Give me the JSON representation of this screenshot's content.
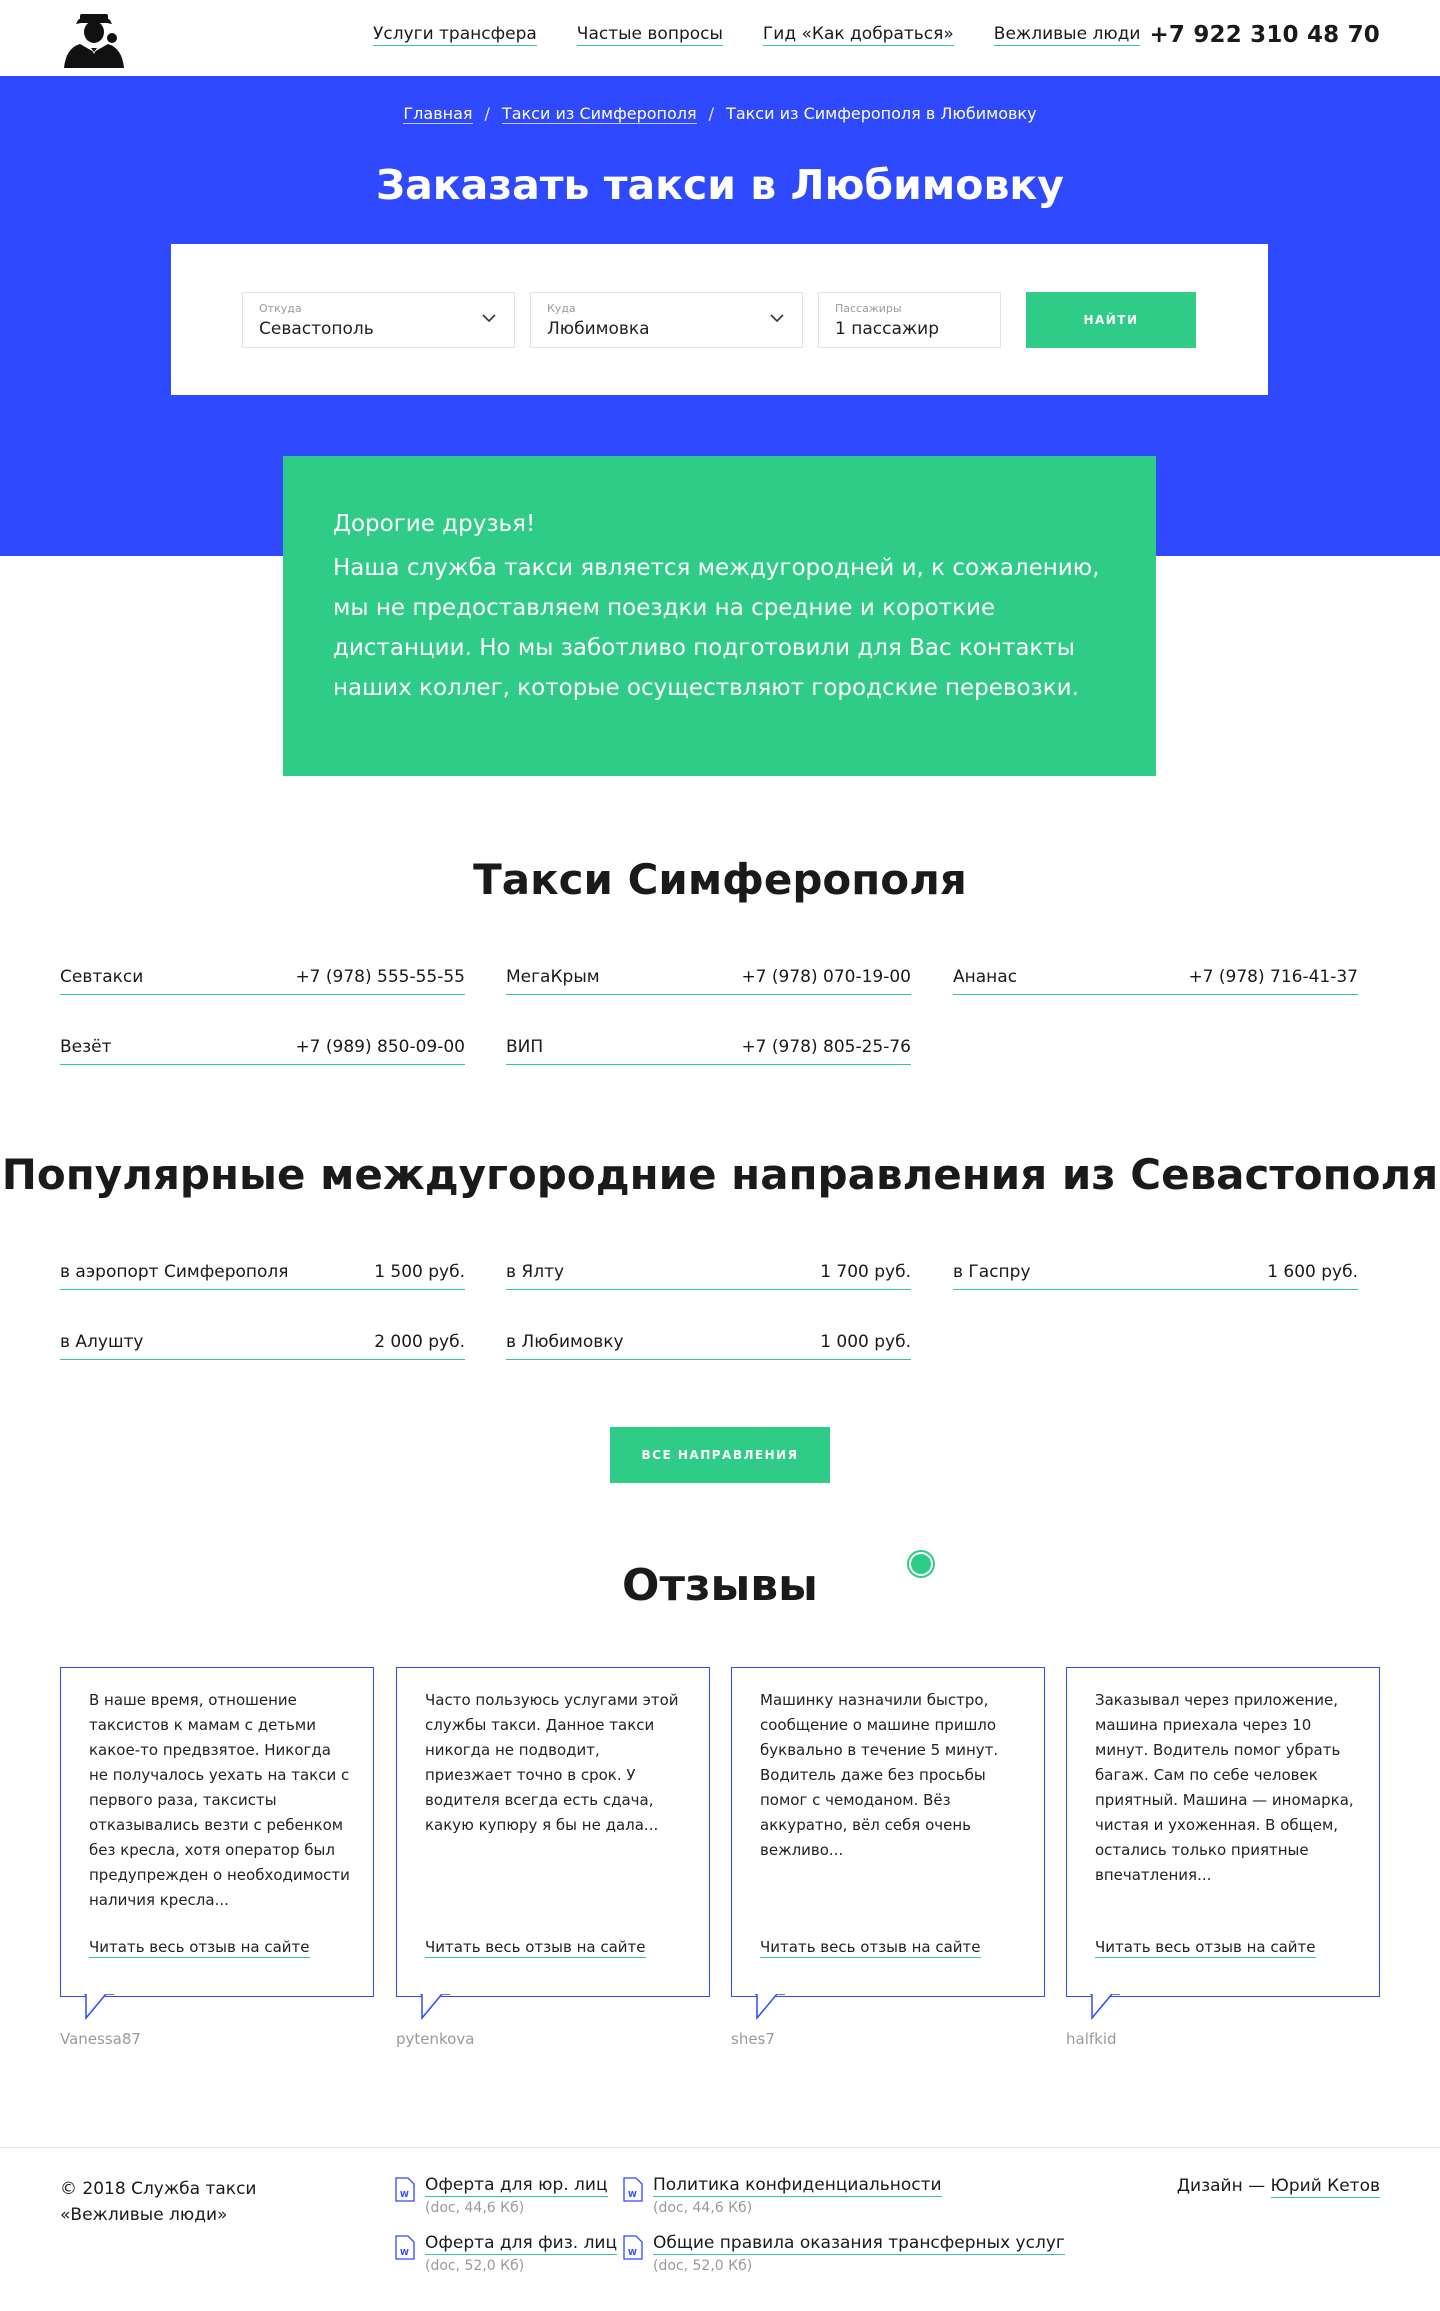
{
  "header": {
    "logo_icon": "gentleman-logo-icon",
    "nav": [
      "Услуги трансфера",
      "Частые вопросы",
      "Гид «Как добраться»",
      "Вежливые люди"
    ],
    "phone": "+7 922 310 48 70"
  },
  "breadcrumbs": {
    "home": "Главная",
    "section": "Такси из Симферополя",
    "current": "Такси из Симферополя в Любимовку",
    "separator": "/"
  },
  "hero": {
    "title": "Заказать такси в Любимовку",
    "background": "#2f49ff"
  },
  "search": {
    "from_label": "Откуда",
    "from_value": "Севастополь",
    "to_label": "Куда",
    "to_value": "Любимовка",
    "passengers_label": "Пассажиры",
    "passengers_value": "1 пассажир",
    "submit": "Найти"
  },
  "notice": {
    "greeting": "Дорогие друзья!",
    "text": "Наша служба такси является междугородней и, к сожалению, мы не предоставляем поездки на средние и короткие дистанции. Но мы заботливо подготовили для Вас контакты наших коллег, которые осуществляют городские перевозки.",
    "background": "#2ecc87"
  },
  "taxi": {
    "title": "Такси Симферополя",
    "items": [
      {
        "name": "Севтакси",
        "phone": "+7 (978) 555-55-55"
      },
      {
        "name": "МегаКрым",
        "phone": "+7 (978) 070-19-00"
      },
      {
        "name": "Ананас",
        "phone": "+7 (978) 716-41-37"
      },
      {
        "name": "Везёт",
        "phone": "+7 (989) 850-09-00"
      },
      {
        "name": "ВИП",
        "phone": "+7 (978) 805-25-76"
      }
    ]
  },
  "routes": {
    "title": "Популярные междугородние направления из Севастополя",
    "items": [
      {
        "name": "в аэропорт Симферополя",
        "price": "1 500 руб."
      },
      {
        "name": "в Ялту",
        "price": "1 700 руб."
      },
      {
        "name": "в Гаспру",
        "price": "1 600 руб."
      },
      {
        "name": "в Алушту",
        "price": "2 000 руб."
      },
      {
        "name": "в Любимовку",
        "price": "1 000 руб."
      }
    ],
    "all_button": "все направления"
  },
  "reviews": {
    "title": "Отзывы",
    "more_label": "Читать весь отзыв на сайте",
    "items": [
      {
        "text": "В наше время, отношение таксистов к мамам с детьми какое-то предвзятое. Никогда не получалось уехать на такси с первого раза, таксисты отказывались везти с ребенком без кресла, хотя оператор был предупрежден о необходимости наличия кресла...",
        "author": "Vanessa87"
      },
      {
        "text": "Часто пользуюсь услугами этой службы такси. Данное такси никогда не подводит, приезжает точно в срок. У водителя всегда есть сдача, какую купюру я бы не дала...",
        "author": "pytenkova"
      },
      {
        "text": "Машинку назначили быстро, сообщение о машине пришло буквально в течение 5 минут. Водитель даже без просьбы помог с чемоданом. Вёз аккуратно, вёл себя очень вежливо...",
        "author": "shes7"
      },
      {
        "text": "Заказывал через приложение, машина приехала через 10 минут. Водитель помог убрать багаж. Сам по себе человек приятный. Машина — иномарка, чистая и ухоженная. В общем, остались только приятные впечатления...",
        "author": "halfkid"
      }
    ]
  },
  "footer": {
    "copyright": "© 2018 Служба такси «Вежливые люди»",
    "docs": [
      {
        "name": "Оферта для юр. лиц",
        "size": "(doc, 44,6 Кб)"
      },
      {
        "name": "Оферта для физ. лиц",
        "size": "(doc, 52,0 Кб)"
      },
      {
        "name": "Политика конфиденциальности",
        "size": "(doc, 44,6 Кб)"
      },
      {
        "name": "Общие правила оказания трансферных услуг",
        "size": "(doc, 52,0 Кб)"
      }
    ],
    "doc_icon": "word-doc-icon",
    "design_prefix": "Дизайн —",
    "designer": "Юрий Кетов"
  },
  "colors": {
    "accent": "#2ecc87",
    "brand": "#2f49ff"
  }
}
